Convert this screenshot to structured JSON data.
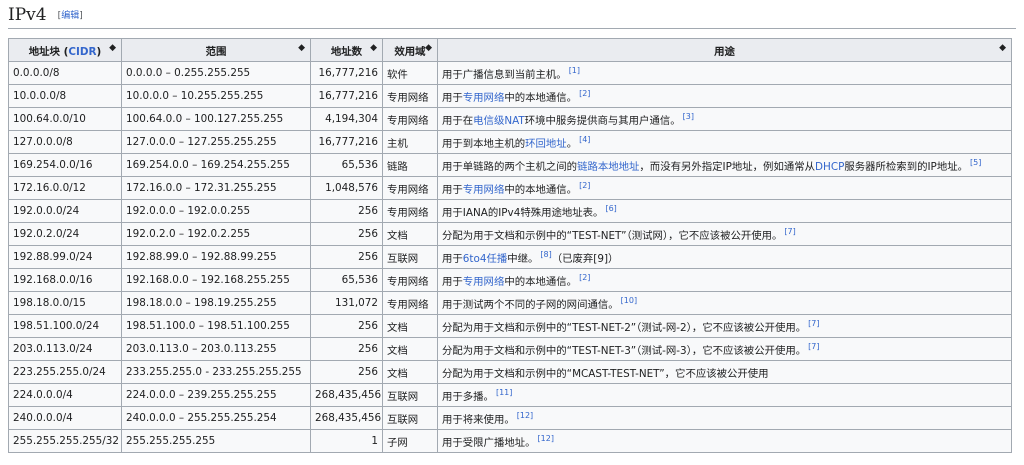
{
  "heading": {
    "title": "IPv4",
    "edit_open": "[",
    "edit_label": "编辑",
    "edit_close": "]"
  },
  "columns": [
    {
      "pre": "地址块 (",
      "link": "CIDR",
      "post": ")"
    },
    {
      "pre": "范围",
      "link": "",
      "post": ""
    },
    {
      "pre": "地址数",
      "link": "",
      "post": ""
    },
    {
      "pre": "效用域",
      "link": "",
      "post": ""
    },
    {
      "pre": "用途",
      "link": "",
      "post": ""
    }
  ],
  "sort_icon": "◆",
  "rows": [
    {
      "block": "0.0.0.0/8",
      "range": "0.0.0.0 – 0.255.255.255",
      "count": "16,777,216",
      "scope": "软件",
      "purpose": [
        {
          "t": "用于广播信息到当前主机。"
        }
      ],
      "ref": "[1]",
      "after": ""
    },
    {
      "block": "10.0.0.0/8",
      "range": "10.0.0.0 – 10.255.255.255",
      "count": "16,777,216",
      "scope": "专用网络",
      "purpose": [
        {
          "t": "用于"
        },
        {
          "t": "专用网络",
          "link": true
        },
        {
          "t": "中的本地通信。"
        }
      ],
      "ref": "[2]",
      "after": ""
    },
    {
      "block": "100.64.0.0/10",
      "range": "100.64.0.0 – 100.127.255.255",
      "count": "4,194,304",
      "scope": "专用网络",
      "purpose": [
        {
          "t": "用于在"
        },
        {
          "t": "电信级NAT",
          "link": true
        },
        {
          "t": "环境中服务提供商与其用户通信。"
        }
      ],
      "ref": "[3]",
      "after": ""
    },
    {
      "block": "127.0.0.0/8",
      "range": "127.0.0.0 – 127.255.255.255",
      "count": "16,777,216",
      "scope": "主机",
      "purpose": [
        {
          "t": "用于到本地主机的"
        },
        {
          "t": "环回地址",
          "link": true
        },
        {
          "t": "。"
        }
      ],
      "ref": "[4]",
      "after": ""
    },
    {
      "block": "169.254.0.0/16",
      "range": "169.254.0.0 – 169.254.255.255",
      "count": "65,536",
      "scope": "链路",
      "purpose": [
        {
          "t": "用于单链路的两个主机之间的"
        },
        {
          "t": "链路本地地址",
          "link": true
        },
        {
          "t": "，而没有另外指定IP地址，例如通常从"
        },
        {
          "t": "DHCP",
          "link": true
        },
        {
          "t": "服务器所检索到的IP地址。"
        }
      ],
      "ref": "[5]",
      "after": ""
    },
    {
      "block": "172.16.0.0/12",
      "range": "172.16.0.0 – 172.31.255.255",
      "count": "1,048,576",
      "scope": "专用网络",
      "purpose": [
        {
          "t": "用于"
        },
        {
          "t": "专用网络",
          "link": true
        },
        {
          "t": "中的本地通信。"
        }
      ],
      "ref": "[2]",
      "after": ""
    },
    {
      "block": "192.0.0.0/24",
      "range": "192.0.0.0 – 192.0.0.255",
      "count": "256",
      "scope": "专用网络",
      "purpose": [
        {
          "t": "用于IANA的IPv4特殊用途地址表。"
        }
      ],
      "ref": "[6]",
      "after": ""
    },
    {
      "block": "192.0.2.0/24",
      "range": "192.0.2.0 – 192.0.2.255",
      "count": "256",
      "scope": "文档",
      "purpose": [
        {
          "t": "分配为用于文档和示例中的“TEST-NET”（测试网），它不应该被公开使用。"
        }
      ],
      "ref": "[7]",
      "after": ""
    },
    {
      "block": "192.88.99.0/24",
      "range": "192.88.99.0 – 192.88.99.255",
      "count": "256",
      "scope": "互联网",
      "purpose": [
        {
          "t": "用于"
        },
        {
          "t": "6to4",
          "link": true
        },
        {
          "t": "任播",
          "link": true
        },
        {
          "t": "中继。"
        }
      ],
      "ref": "[8]",
      "after": "（已废弃[9]）"
    },
    {
      "block": "192.168.0.0/16",
      "range": "192.168.0.0 – 192.168.255.255",
      "count": "65,536",
      "scope": "专用网络",
      "purpose": [
        {
          "t": "用于"
        },
        {
          "t": "专用网络",
          "link": true
        },
        {
          "t": "中的本地通信。"
        }
      ],
      "ref": "[2]",
      "after": ""
    },
    {
      "block": "198.18.0.0/15",
      "range": "198.18.0.0 – 198.19.255.255",
      "count": "131,072",
      "scope": "专用网络",
      "purpose": [
        {
          "t": "用于测试两个不同的子网的网间通信。"
        }
      ],
      "ref": "[10]",
      "after": ""
    },
    {
      "block": "198.51.100.0/24",
      "range": "198.51.100.0 – 198.51.100.255",
      "count": "256",
      "scope": "文档",
      "purpose": [
        {
          "t": "分配为用于文档和示例中的“TEST-NET-2”（测试-网-2），它不应该被公开使用。"
        }
      ],
      "ref": "[7]",
      "after": ""
    },
    {
      "block": "203.0.113.0/24",
      "range": "203.0.113.0 – 203.0.113.255",
      "count": "256",
      "scope": "文档",
      "purpose": [
        {
          "t": "分配为用于文档和示例中的“TEST-NET-3”（测试-网-3），它不应该被公开使用。"
        }
      ],
      "ref": "[7]",
      "after": ""
    },
    {
      "block": "223.255.255.0/24",
      "range": "233.255.255.0 - 233.255.255.255",
      "count": "256",
      "scope": "文档",
      "purpose": [
        {
          "t": "分配为用于文档和示例中的“MCAST-TEST-NET”，它不应该被公开使用"
        }
      ],
      "ref": "",
      "after": ""
    },
    {
      "block": "224.0.0.0/4",
      "range": "224.0.0.0 – 239.255.255.255",
      "count": "268,435,456",
      "scope": "互联网",
      "purpose": [
        {
          "t": "用于多播。"
        }
      ],
      "ref": "[11]",
      "after": ""
    },
    {
      "block": "240.0.0.0/4",
      "range": "240.0.0.0 – 255.255.255.254",
      "count": "268,435,456",
      "scope": "互联网",
      "purpose": [
        {
          "t": "用于将来使用。"
        }
      ],
      "ref": "[12]",
      "after": ""
    },
    {
      "block": "255.255.255.255/32",
      "range": "255.255.255.255",
      "count": "1",
      "scope": "子网",
      "purpose": [
        {
          "t": "用于受限广播地址。"
        }
      ],
      "ref": "[12]",
      "after": ""
    }
  ]
}
